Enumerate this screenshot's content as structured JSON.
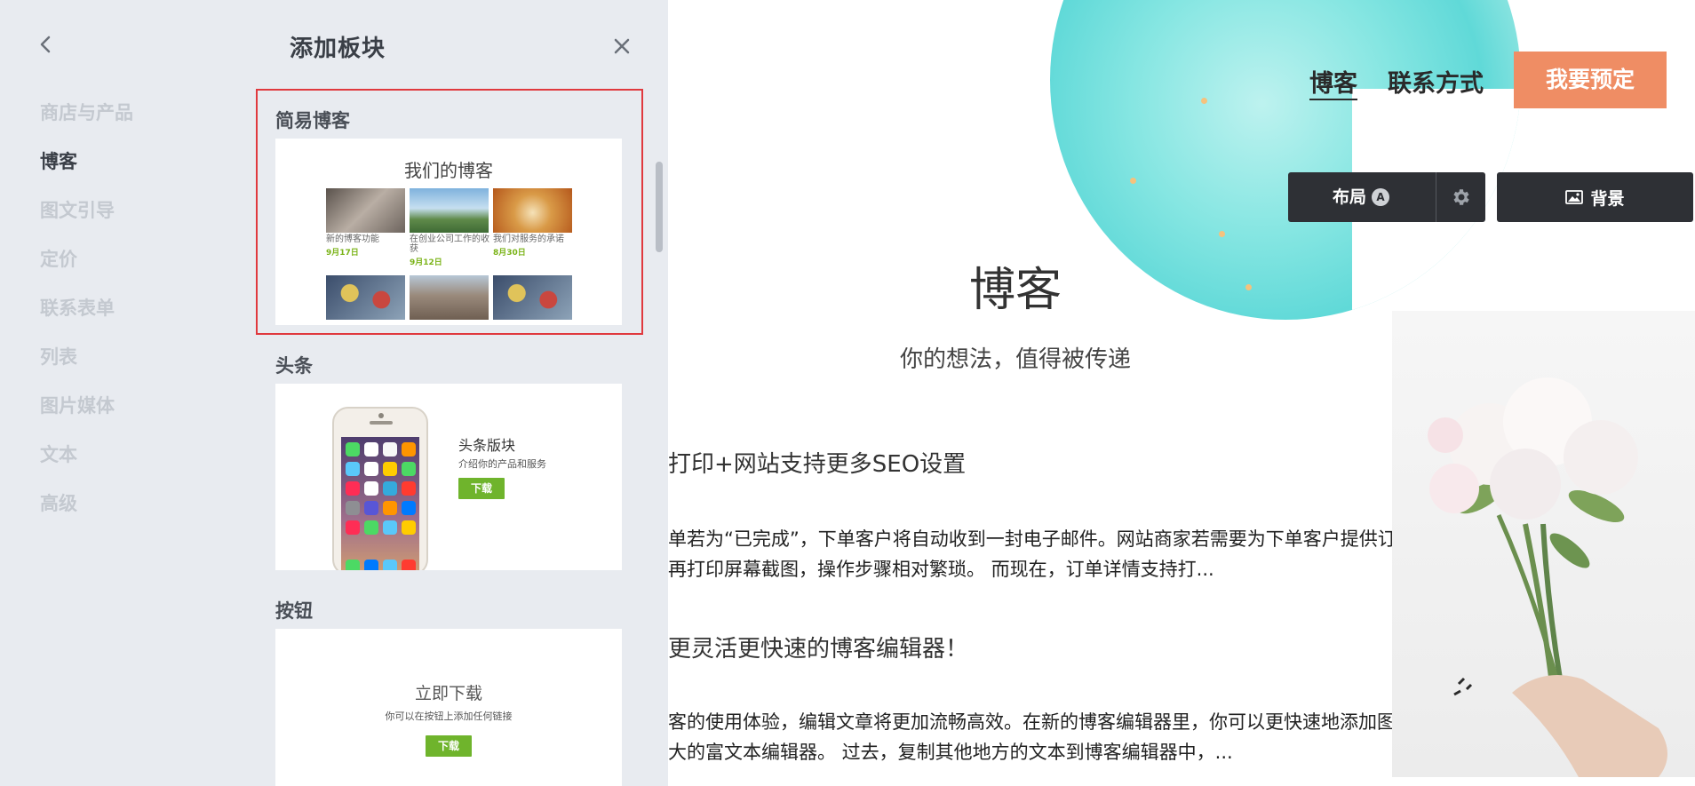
{
  "panel": {
    "title": "添加板块",
    "categories": [
      "商店与产品",
      "博客",
      "图文引导",
      "定价",
      "联系表单",
      "列表",
      "图片媒体",
      "文本",
      "高级"
    ],
    "active_category": "博客",
    "sections": {
      "simple_blog": {
        "label": "简易博客",
        "preview_title": "我们的博客",
        "posts": [
          {
            "caption": "新的博客功能",
            "date": "9月17日"
          },
          {
            "caption": "在创业公司工作的收获",
            "date": "9月12日"
          },
          {
            "caption": "我们对服务的承诺",
            "date": "8月30日"
          }
        ],
        "thumb_colors": [
          "#8a7f76",
          "#5c8bb8",
          "#d47a2a",
          "#6b6f8c",
          "#a08f80",
          "#6b6f8c"
        ]
      },
      "headline": {
        "label": "头条",
        "preview_title": "头条版块",
        "preview_subtitle": "介绍你的产品和服务",
        "button_label": "下载"
      },
      "button": {
        "label": "按钮",
        "preview_title": "立即下载",
        "preview_subtitle": "你可以在按钮上添加任何链接",
        "button_label": "下载"
      }
    }
  },
  "site": {
    "nav": [
      "博客",
      "联系方式"
    ],
    "cta_label": "我要预定",
    "toolbar": {
      "layout_label": "布局",
      "layout_badge": "A",
      "background_label": "背景"
    },
    "blog_title": "博客",
    "blog_subtitle": "你的想法，值得被传递",
    "posts": [
      {
        "title": "打印+网站支持更多SEO设置",
        "lines": [
          "单若为“已完成”，下单客户将自动收到一封电子邮件。网站商家若需要为下单客户提供订购单，大部分是先将邮",
          "再打印屏幕截图，操作步骤相对繁琐。 而现在，订单详情支持打..."
        ]
      },
      {
        "title": "更灵活更快速的博客编辑器！",
        "lines": [
          "客的使用体验，编辑文章将更加流畅高效。在新的博客编辑器里，你可以更快速地添加图片、复制粘贴文字内",
          "大的富文本编辑器。 过去，复制其他地方的文本到博客编辑器中，..."
        ]
      }
    ]
  },
  "colors": {
    "panel_bg": "#e8ebf0",
    "selected_border": "#e0393e",
    "cta": "#ef8d64",
    "toolbar_bg": "#2e3035",
    "download_green": "#6fb42c",
    "blob": "#86e6e2"
  }
}
